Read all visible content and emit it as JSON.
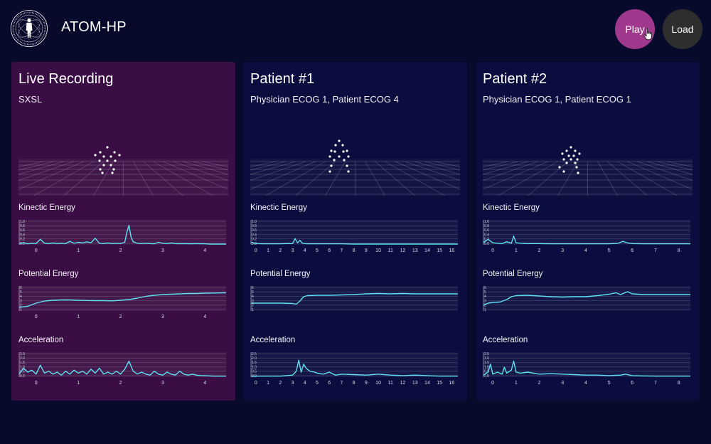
{
  "app": {
    "title": "ATOM-HP",
    "logo_text": "ATOM-HP · ANALYSIS TOOLS OF MOVEMENT · ASSESSMENT OF HEALTH"
  },
  "toolbar": {
    "play_label": "Play",
    "load_label": "Load"
  },
  "colors": {
    "background": "#070a2a",
    "live_panel": "#3a0e44",
    "patient_panel": "#0a0d3e",
    "play_button": "#a0398e",
    "load_button": "#2e2e2e",
    "signal_line": "#5ee0f0"
  },
  "icons": [
    "human-figure-logo-icon",
    "hand-cursor-icon"
  ],
  "panels": [
    {
      "title": "Live Recording",
      "subtitle": "SXSL",
      "charts": [
        {
          "title": "Kinectic Energy",
          "yticks": [
            "1.0",
            "0.8",
            "0.6",
            "0.4",
            "0.2",
            "0.0"
          ],
          "xticks": [
            "0",
            "1",
            "2",
            "3",
            "4"
          ]
        },
        {
          "title": "Potential Energy",
          "yticks": [
            "6",
            "5",
            "4",
            "3",
            "2",
            "1"
          ],
          "xticks": [
            "0",
            "1",
            "2",
            "3",
            "4"
          ]
        },
        {
          "title": "Acceleration",
          "yticks": [
            "2.5",
            "2.0",
            "1.5",
            "1.0",
            "0.5",
            "0.0"
          ],
          "xticks": [
            "0",
            "1",
            "2",
            "3",
            "4"
          ]
        }
      ]
    },
    {
      "title": "Patient #1",
      "subtitle": "Physician ECOG 1, Patient ECOG 4",
      "charts": [
        {
          "title": "Kinectic Energy",
          "yticks": [
            "1.0",
            "0.8",
            "0.6",
            "0.4",
            "0.2",
            "0.0"
          ],
          "xticks": [
            "0",
            "1",
            "2",
            "3",
            "4",
            "5",
            "6",
            "7",
            "8",
            "9",
            "10",
            "11",
            "12",
            "13",
            "14",
            "15",
            "16"
          ]
        },
        {
          "title": "Potential Energy",
          "yticks": [
            "6",
            "5",
            "4",
            "3",
            "2",
            "1"
          ],
          "xticks": []
        },
        {
          "title": "Acceleration",
          "yticks": [
            "2.5",
            "2.0",
            "1.5",
            "1.0",
            "0.5",
            "0.0"
          ],
          "xticks": [
            "0",
            "1",
            "2",
            "3",
            "4",
            "5",
            "6",
            "7",
            "8",
            "9",
            "10",
            "11",
            "12",
            "13",
            "14",
            "15",
            "16"
          ]
        }
      ]
    },
    {
      "title": "Patient #2",
      "subtitle": "Physician ECOG 1, Patient ECOG 1",
      "charts": [
        {
          "title": "Kinectic Energy",
          "yticks": [
            "1.0",
            "0.8",
            "0.6",
            "0.4",
            "0.2",
            "0.0"
          ],
          "xticks": [
            "0",
            "1",
            "2",
            "3",
            "4",
            "5",
            "6",
            "7",
            "8"
          ]
        },
        {
          "title": "Potential Energy",
          "yticks": [
            "6",
            "5",
            "4",
            "3",
            "2",
            "1"
          ],
          "xticks": []
        },
        {
          "title": "Acceleration",
          "yticks": [
            "2.5",
            "2.0",
            "1.5",
            "1.0",
            "0.5",
            "0.0"
          ],
          "xticks": [
            "0",
            "1",
            "2",
            "3",
            "4",
            "5",
            "6",
            "7",
            "8"
          ]
        }
      ]
    }
  ],
  "chart_data": [
    {
      "type": "line",
      "panel": "Live Recording",
      "title": "Kinectic Energy",
      "xlim": [
        -0.4,
        4.5
      ],
      "ylim": [
        0,
        1.0
      ],
      "x": [
        -0.4,
        -0.3,
        -0.2,
        -0.1,
        0,
        0.1,
        0.2,
        0.3,
        0.4,
        0.5,
        0.6,
        0.7,
        0.8,
        0.9,
        1.0,
        1.1,
        1.2,
        1.3,
        1.4,
        1.5,
        1.6,
        1.7,
        1.8,
        1.9,
        2.0,
        2.1,
        2.15,
        2.2,
        2.25,
        2.3,
        2.4,
        2.5,
        2.6,
        2.7,
        2.8,
        2.9,
        3.0,
        3.1,
        3.2,
        3.3,
        3.4,
        3.5,
        3.6,
        3.7,
        3.8,
        3.9,
        4.0,
        4.1,
        4.2,
        4.3,
        4.4,
        4.5
      ],
      "y": [
        0.05,
        0.08,
        0.04,
        0.06,
        0.05,
        0.22,
        0.06,
        0.05,
        0.07,
        0.05,
        0.06,
        0.05,
        0.14,
        0.06,
        0.1,
        0.07,
        0.12,
        0.08,
        0.26,
        0.06,
        0.05,
        0.07,
        0.05,
        0.06,
        0.05,
        0.1,
        0.5,
        0.78,
        0.3,
        0.12,
        0.06,
        0.05,
        0.06,
        0.05,
        0.04,
        0.1,
        0.06,
        0.05,
        0.07,
        0.05,
        0.04,
        0.05,
        0.04,
        0.04,
        0.05,
        0.04,
        0.04,
        0.03,
        0.03,
        0.03,
        0.03,
        0.03
      ]
    },
    {
      "type": "line",
      "panel": "Live Recording",
      "title": "Potential Energy",
      "xlim": [
        -0.4,
        4.5
      ],
      "ylim": [
        0,
        7
      ],
      "x": [
        -0.4,
        -0.2,
        0,
        0.2,
        0.4,
        0.6,
        0.8,
        1.0,
        1.2,
        1.4,
        1.6,
        1.8,
        2.0,
        2.2,
        2.4,
        2.6,
        2.8,
        3.0,
        3.2,
        3.4,
        3.6,
        3.8,
        4.0,
        4.2,
        4.5
      ],
      "y": [
        1.0,
        1.3,
        2.2,
        2.8,
        3.0,
        3.1,
        3.1,
        3.0,
        2.95,
        2.9,
        2.9,
        2.85,
        3.0,
        3.2,
        3.6,
        4.1,
        4.4,
        4.6,
        4.7,
        4.8,
        4.9,
        4.9,
        5.0,
        5.05,
        5.1
      ]
    },
    {
      "type": "line",
      "panel": "Live Recording",
      "title": "Acceleration",
      "xlim": [
        -0.4,
        4.5
      ],
      "ylim": [
        0,
        2.5
      ],
      "x": [
        -0.4,
        -0.3,
        -0.2,
        -0.1,
        0,
        0.1,
        0.2,
        0.3,
        0.4,
        0.5,
        0.6,
        0.7,
        0.8,
        0.9,
        1.0,
        1.1,
        1.2,
        1.3,
        1.4,
        1.5,
        1.6,
        1.7,
        1.8,
        1.9,
        2.0,
        2.1,
        2.2,
        2.3,
        2.4,
        2.5,
        2.6,
        2.7,
        2.8,
        2.9,
        3.0,
        3.1,
        3.2,
        3.3,
        3.4,
        3.5,
        3.6,
        3.7,
        3.8,
        3.9,
        4.0,
        4.2,
        4.5
      ],
      "y": [
        0.3,
        0.9,
        0.5,
        0.7,
        0.3,
        1.2,
        0.4,
        0.6,
        0.3,
        0.5,
        0.2,
        0.6,
        0.3,
        0.7,
        0.4,
        0.6,
        0.3,
        0.8,
        0.4,
        0.9,
        0.3,
        0.5,
        0.3,
        0.6,
        0.3,
        0.8,
        1.6,
        0.6,
        0.3,
        0.5,
        0.3,
        0.2,
        0.6,
        0.3,
        0.2,
        0.5,
        0.3,
        0.2,
        0.6,
        0.3,
        0.2,
        0.3,
        0.2,
        0.15,
        0.15,
        0.1,
        0.1
      ]
    },
    {
      "type": "line",
      "panel": "Patient #1",
      "title": "Kinectic Energy",
      "xlim": [
        -0.4,
        16.5
      ],
      "ylim": [
        0,
        1.0
      ],
      "x": [
        -0.4,
        0,
        0.5,
        1,
        1.5,
        2,
        2.5,
        3,
        3.2,
        3.4,
        3.6,
        3.8,
        4,
        4.2,
        4.5,
        5,
        6,
        7,
        8,
        9,
        10,
        11,
        12,
        13,
        14,
        15,
        16,
        16.5
      ],
      "y": [
        0.1,
        0.05,
        0.04,
        0.04,
        0.04,
        0.04,
        0.05,
        0.05,
        0.25,
        0.08,
        0.18,
        0.06,
        0.05,
        0.04,
        0.04,
        0.04,
        0.04,
        0.04,
        0.03,
        0.03,
        0.03,
        0.03,
        0.03,
        0.03,
        0.03,
        0.03,
        0.03,
        0.03
      ]
    },
    {
      "type": "line",
      "panel": "Patient #1",
      "title": "Potential Energy",
      "xlim": [
        -0.4,
        16.5
      ],
      "ylim": [
        0,
        7
      ],
      "x": [
        -0.4,
        0.5,
        1,
        2,
        3,
        3.3,
        3.6,
        3.9,
        4.2,
        5,
        6,
        7,
        8,
        9,
        10,
        11,
        12,
        13,
        14,
        15,
        16,
        16.5
      ],
      "y": [
        2.2,
        2.2,
        2.2,
        2.2,
        2.1,
        1.9,
        2.8,
        4.0,
        4.3,
        4.4,
        4.4,
        4.5,
        4.6,
        4.8,
        4.9,
        4.8,
        4.9,
        4.8,
        4.8,
        4.8,
        4.8,
        4.8
      ]
    },
    {
      "type": "line",
      "panel": "Patient #1",
      "title": "Acceleration",
      "xlim": [
        -0.4,
        16.5
      ],
      "ylim": [
        0,
        2.5
      ],
      "x": [
        -0.4,
        0,
        1,
        2,
        3,
        3.3,
        3.5,
        3.7,
        3.9,
        4.1,
        4.4,
        4.8,
        5,
        5.5,
        6,
        6.5,
        7,
        8,
        9,
        10,
        11,
        12,
        13,
        14,
        15,
        16,
        16.5
      ],
      "y": [
        0.1,
        0.1,
        0.1,
        0.1,
        0.2,
        0.6,
        1.7,
        0.5,
        1.3,
        0.9,
        0.6,
        0.5,
        0.4,
        0.3,
        0.5,
        0.2,
        0.3,
        0.25,
        0.2,
        0.3,
        0.2,
        0.15,
        0.2,
        0.15,
        0.1,
        0.1,
        0.1
      ]
    },
    {
      "type": "line",
      "panel": "Patient #2",
      "title": "Kinectic Energy",
      "xlim": [
        -0.4,
        8.5
      ],
      "ylim": [
        0,
        1.0
      ],
      "x": [
        -0.4,
        -0.2,
        0,
        0.2,
        0.4,
        0.6,
        0.8,
        0.9,
        1.0,
        1.2,
        1.5,
        2,
        2.5,
        3,
        3.5,
        4,
        4.5,
        5,
        5.4,
        5.6,
        5.8,
        6,
        6.5,
        7,
        7.5,
        8,
        8.5
      ],
      "y": [
        0.1,
        0.22,
        0.08,
        0.06,
        0.05,
        0.12,
        0.06,
        0.35,
        0.08,
        0.06,
        0.05,
        0.05,
        0.04,
        0.04,
        0.04,
        0.04,
        0.04,
        0.04,
        0.06,
        0.14,
        0.07,
        0.05,
        0.04,
        0.04,
        0.04,
        0.04,
        0.04
      ]
    },
    {
      "type": "line",
      "panel": "Patient #2",
      "title": "Potential Energy",
      "xlim": [
        -0.4,
        8.5
      ],
      "ylim": [
        0,
        7
      ],
      "x": [
        -0.4,
        -0.2,
        0,
        0.3,
        0.6,
        0.8,
        1.0,
        1.5,
        2,
        2.5,
        3,
        3.5,
        4,
        4.5,
        5,
        5.3,
        5.5,
        5.8,
        6,
        6.5,
        7,
        7.5,
        8,
        8.5
      ],
      "y": [
        1.6,
        2.2,
        2.4,
        2.5,
        3.2,
        4.0,
        4.3,
        4.4,
        4.2,
        4.0,
        3.9,
        4.0,
        4.0,
        4.3,
        4.7,
        5.1,
        4.6,
        5.4,
        4.8,
        4.6,
        4.6,
        4.6,
        4.6,
        4.6
      ]
    },
    {
      "type": "line",
      "panel": "Patient #2",
      "title": "Acceleration",
      "xlim": [
        -0.4,
        8.5
      ],
      "ylim": [
        0,
        2.5
      ],
      "x": [
        -0.4,
        -0.2,
        -0.1,
        0,
        0.2,
        0.4,
        0.5,
        0.6,
        0.8,
        0.9,
        1.0,
        1.2,
        1.5,
        2,
        2.5,
        3,
        3.5,
        4,
        4.5,
        5,
        5.5,
        5.7,
        6,
        6.5,
        7,
        7.5,
        8,
        8.5
      ],
      "y": [
        0.2,
        0.5,
        1.3,
        0.3,
        0.5,
        0.3,
        1.0,
        0.4,
        0.7,
        1.6,
        0.5,
        0.4,
        0.5,
        0.3,
        0.35,
        0.3,
        0.25,
        0.2,
        0.2,
        0.15,
        0.2,
        0.3,
        0.15,
        0.12,
        0.1,
        0.1,
        0.1,
        0.1
      ]
    }
  ]
}
